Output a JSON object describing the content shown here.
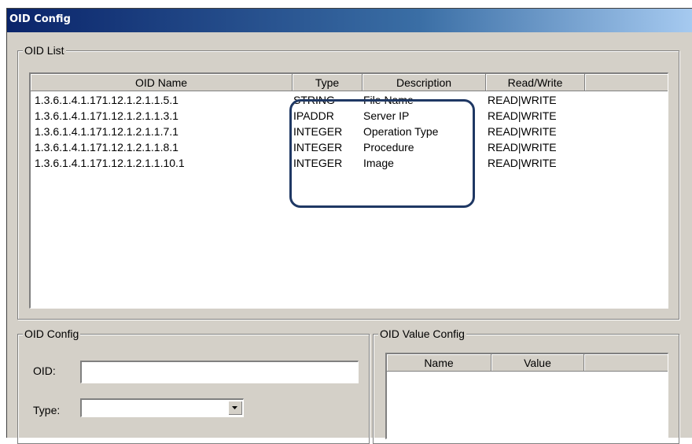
{
  "window": {
    "title": "OID Config"
  },
  "oid_list": {
    "group_label": "OID List",
    "columns": [
      "OID Name",
      "Type",
      "Description",
      "Read/Write"
    ],
    "rows": [
      {
        "oid": "1.3.6.1.4.1.171.12.1.2.1.1.5.1",
        "type": "STRING",
        "description": "File Name",
        "rw": "READ|WRITE"
      },
      {
        "oid": "1.3.6.1.4.1.171.12.1.2.1.1.3.1",
        "type": "IPADDR",
        "description": "Server IP",
        "rw": "READ|WRITE"
      },
      {
        "oid": "1.3.6.1.4.1.171.12.1.2.1.1.7.1",
        "type": "INTEGER",
        "description": "Operation Type",
        "rw": "READ|WRITE"
      },
      {
        "oid": "1.3.6.1.4.1.171.12.1.2.1.1.8.1",
        "type": "INTEGER",
        "description": "Procedure",
        "rw": "READ|WRITE"
      },
      {
        "oid": "1.3.6.1.4.1.171.12.1.2.1.1.10.1",
        "type": "INTEGER",
        "description": "Image",
        "rw": "READ|WRITE"
      }
    ]
  },
  "oid_config": {
    "group_label": "OID Config",
    "oid_label": "OID:",
    "oid_value": "",
    "type_label": "Type:",
    "type_value": ""
  },
  "oid_value_config": {
    "group_label": "OID Value Config",
    "columns": [
      "Name",
      "Value"
    ]
  },
  "colors": {
    "highlight_outline": "#1f3864",
    "title_bar": "#0a246a",
    "dialog_face": "#d4d0c8"
  },
  "icons": {
    "combo_dropdown": "chevron-down-icon"
  }
}
